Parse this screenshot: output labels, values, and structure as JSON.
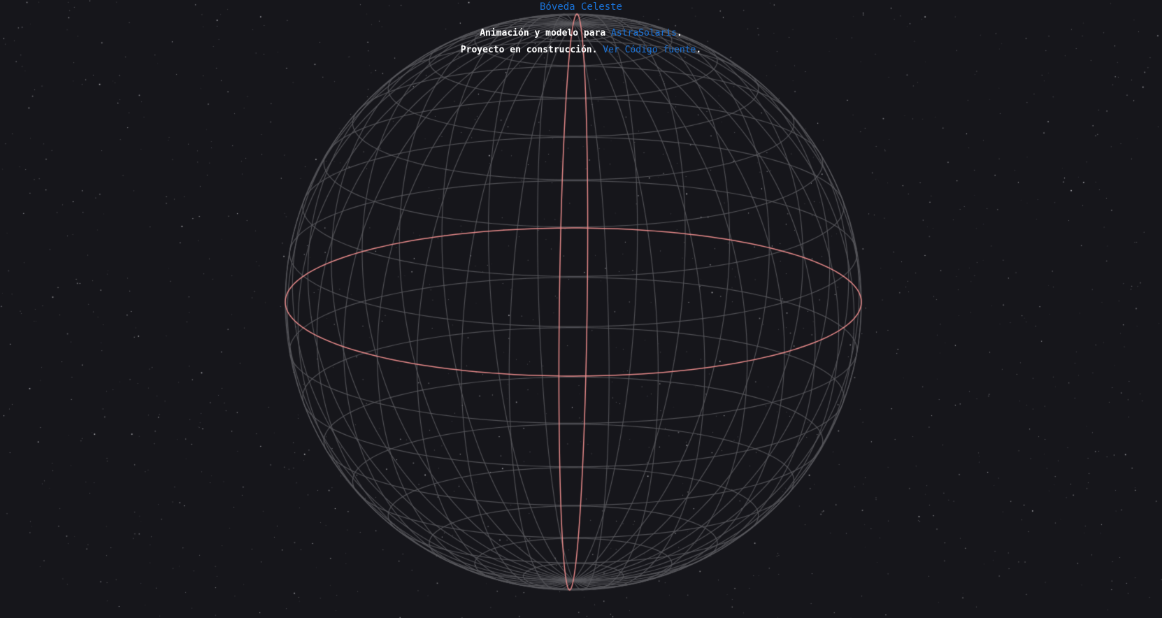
{
  "page": {
    "title": "Bóveda Celeste",
    "line1": {
      "text": "Animación y modelo para ",
      "link": "AstraSolaris",
      "suffix": "."
    },
    "line2": {
      "text": "Proyecto en construcción. ",
      "link": "Ver Código fuente",
      "suffix": "."
    }
  },
  "colors": {
    "background": "#16161b",
    "link": "#1a73d9",
    "title": "#1a73d9",
    "grid": "#5a5a5f",
    "highlight": "#e88a8a",
    "stars": "#c8c8c8"
  },
  "scene": {
    "object": "wireframe celestial sphere",
    "highlighted_circles": [
      "equator",
      "meridian"
    ],
    "meridian_count": 36,
    "parallel_count": 18,
    "starfield": true
  }
}
